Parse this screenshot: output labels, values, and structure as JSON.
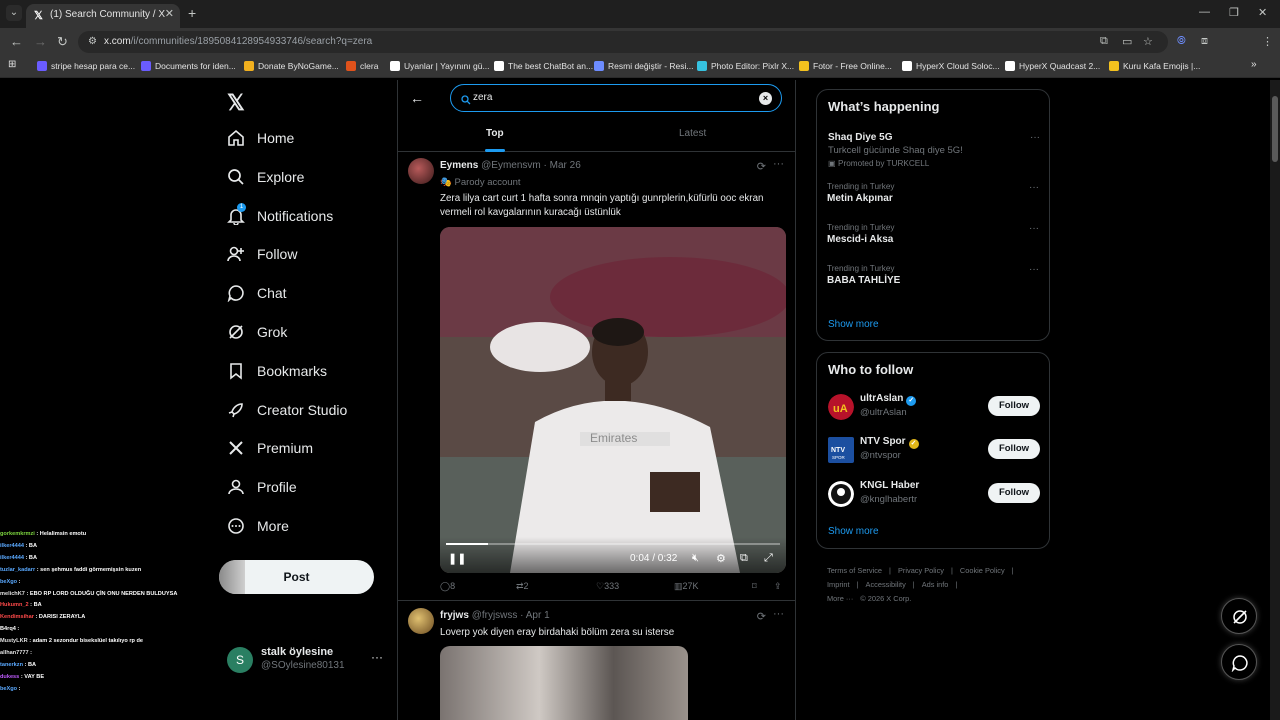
{
  "browser": {
    "tab_title": "(1) Search Community / X",
    "url_host": "x.com",
    "url_path": "/i/communities/1895084128954933746/search?q=zera",
    "bookmarks": [
      {
        "label": "stripe hesap para ce...",
        "color": "#6a5cff"
      },
      {
        "label": "Documents for iden...",
        "color": "#6a5cff"
      },
      {
        "label": "Donate ByNoGame...",
        "color": "#f2b01e"
      },
      {
        "label": "clera",
        "color": "#e0521b"
      },
      {
        "label": "Uyanlar | Yayınını gü...",
        "color": "#ffffff"
      },
      {
        "label": "The best ChatBot an...",
        "color": "#ffffff"
      },
      {
        "label": "Resmi değiştir - Resi...",
        "color": "#6d8cff"
      },
      {
        "label": "Photo Editor: Pixlr X...",
        "color": "#36c2e0"
      },
      {
        "label": "Fotor - Free Online...",
        "color": "#f4c21e"
      },
      {
        "label": "HyperX Cloud Soloc...",
        "color": "#ffffff"
      },
      {
        "label": "HyperX Quadcast 2...",
        "color": "#ffffff"
      },
      {
        "label": "Kuru Kafa Emojis |...",
        "color": "#f4c21e"
      }
    ]
  },
  "nav": {
    "items": [
      {
        "label": "Home",
        "icon": "home-icon"
      },
      {
        "label": "Explore",
        "icon": "search-icon"
      },
      {
        "label": "Notifications",
        "icon": "bell-icon"
      },
      {
        "label": "Follow",
        "icon": "add-person-icon"
      },
      {
        "label": "Chat",
        "icon": "chat-icon"
      },
      {
        "label": "Grok",
        "icon": "grok-icon"
      },
      {
        "label": "Bookmarks",
        "icon": "bookmark-icon"
      },
      {
        "label": "Creator Studio",
        "icon": "rocket-icon"
      },
      {
        "label": "Premium",
        "icon": "x-icon"
      },
      {
        "label": "Profile",
        "icon": "person-icon"
      },
      {
        "label": "More",
        "icon": "more-circle-icon"
      }
    ],
    "notif_badge": "1",
    "post_label": "Post",
    "account": {
      "initial": "S",
      "name": "stalk öylesine",
      "handle": "@SOylesine80131"
    }
  },
  "chat_overlay": [
    {
      "user": "gorkemkrmzi",
      "text": ": Helalimsin emotu",
      "color": "#7dd63f"
    },
    {
      "user": "ilker4444",
      "text": ": BA",
      "color": "#5aa9ff"
    },
    {
      "user": "ilker4444",
      "text": ": BA",
      "color": "#5aa9ff"
    },
    {
      "user": "tuzlar_kadarr",
      "text": ": sen şehmus faddi görmemişsin kuzen",
      "color": "#5aa9ff"
    },
    {
      "user": "beXgo",
      "text": ":",
      "color": "#5aa9ff"
    },
    {
      "user": "melichK7",
      "text": ": EBO RP LORD OLDUĞU ÇİN ONU NERDEN BULDUYSA",
      "color": "#e0e0e0"
    },
    {
      "user": "Hukumn_2",
      "text": ": BA",
      "color": "#ff4a4a"
    },
    {
      "user": "Kendimsihar",
      "text": ": DARISI ZERAYLA",
      "color": "#ff4a4a"
    },
    {
      "user": "B4rq4",
      "text": ":",
      "color": "#ffffff"
    },
    {
      "user": "MustyLKR",
      "text": ": adam 2 sezondur bisekslüel takılıyo rp de",
      "color": "#e0e0e0"
    },
    {
      "user": "allhan7777",
      "text": ":",
      "color": "#e0e0e0"
    },
    {
      "user": "tanerkzn",
      "text": ": BA",
      "color": "#5aa9ff"
    },
    {
      "user": "dukess",
      "text": ": VAY BE",
      "color": "#c05cff"
    },
    {
      "user": "beXgo",
      "text": ":",
      "color": "#5aa9ff"
    }
  ],
  "center": {
    "search_value": "zera",
    "tabs": [
      {
        "label": "Top"
      },
      {
        "label": "Latest"
      }
    ],
    "post1": {
      "name": "Eymens",
      "meta": "@Eymensvm · Mar 26",
      "parody": "Parody account",
      "text": "Zera lilya cart curt 1 hafta sonra mnqin yaptığı gunrplerin,küfürlü ooc ekran vermeli rol kavgalarının kuracağı üstünlük",
      "video": {
        "time": "0:04 / 0:32",
        "progress": 0.125
      },
      "stats": {
        "replies": "8",
        "reposts": "2",
        "likes": "333",
        "views": "27K"
      }
    },
    "post2": {
      "name": "fryjws",
      "meta": "@fryjswss · Apr 1",
      "text": "Loverp yok diyen eray birdahaki bölüm zera su isterse"
    }
  },
  "right": {
    "happening": {
      "title": "What’s happening",
      "promo": {
        "name": "Shaq Diye 5G",
        "desc": "Turkcell gücünde Shaq diye 5G!",
        "promoted": "Promoted by TURKCELL"
      },
      "trends": [
        {
          "cat": "Trending in Turkey",
          "name": "Metin Akpınar"
        },
        {
          "cat": "Trending in Turkey",
          "name": "Mescid-i Aksa"
        },
        {
          "cat": "Trending in Turkey",
          "name": "BABA TAHLİYE"
        }
      ],
      "show_more": "Show more"
    },
    "who_to_follow": {
      "title": "Who to follow",
      "accounts": [
        {
          "name": "ultrAslan",
          "handle": "@ultrAslan",
          "badge_color": "#1d9bf0",
          "follow": "Follow"
        },
        {
          "name": "NTV Spor",
          "handle": "@ntvspor",
          "badge_color": "#e2b719",
          "follow": "Follow"
        },
        {
          "name": "KNGL Haber",
          "handle": "@knglhabertr",
          "badge_color": "",
          "follow": "Follow"
        }
      ],
      "show_more": "Show more"
    },
    "footer": [
      "Terms of Service",
      "|",
      "Privacy Policy",
      "|",
      "Cookie Policy",
      "|",
      "Imprint",
      "|",
      "Accessibility",
      "|",
      "Ads info",
      "|",
      "More ···",
      "© 2026 X Corp."
    ]
  }
}
